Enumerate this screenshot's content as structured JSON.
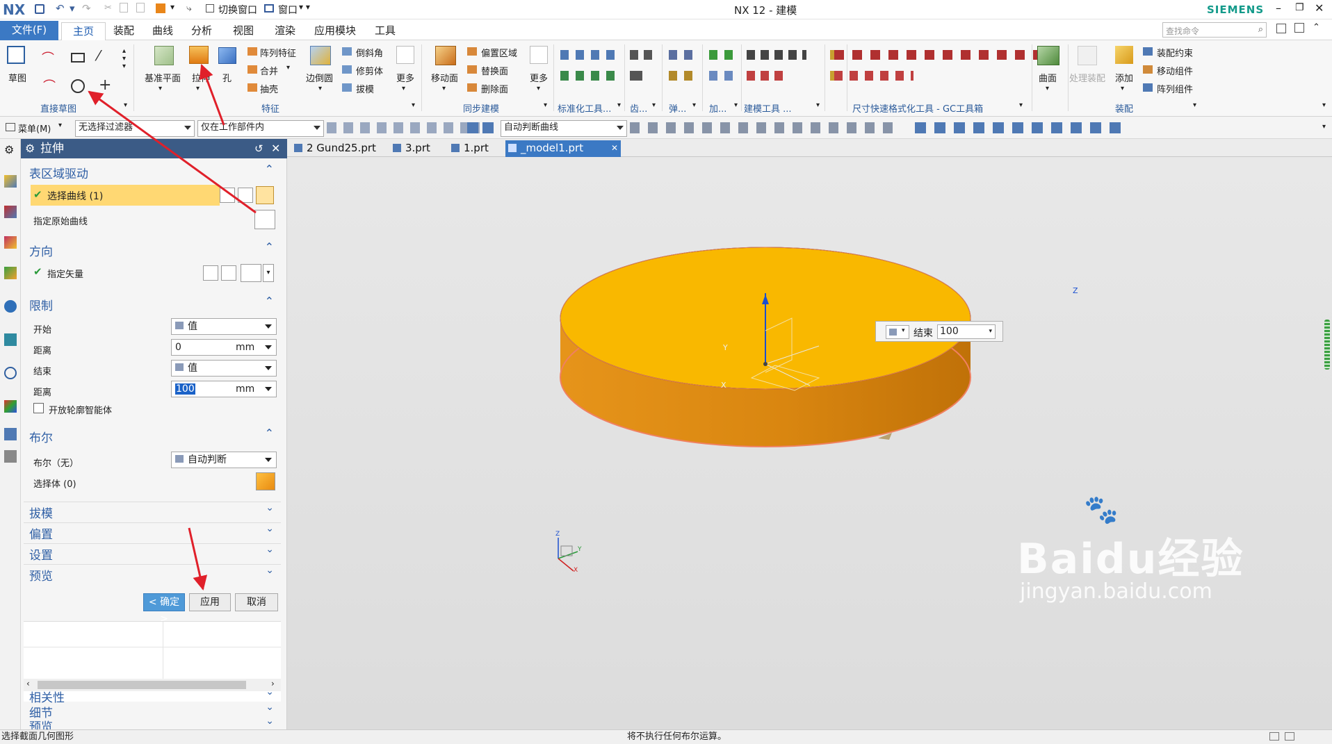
{
  "titlebar": {
    "logo": "NX",
    "quick_switch_window": "切换窗口",
    "quick_window": "窗口",
    "title": "NX 12 - 建模",
    "brand": "SIEMENS",
    "search_placeholder": "查找命令"
  },
  "menutabs": [
    "文件(F)",
    "主页",
    "装配",
    "曲线",
    "分析",
    "视图",
    "渲染",
    "应用模块",
    "工具"
  ],
  "ribbon": {
    "sketch": "草图",
    "direct_sketch_group": "直接草图",
    "datum_plane": "基准平面",
    "extrude": "拉伸",
    "hole": "孔",
    "pattern_feature": "阵列特征",
    "unite": "合并",
    "shell": "抽壳",
    "edge_blend": "边倒圆",
    "chamfer": "倒斜角",
    "trim_body": "修剪体",
    "draft": "拔模",
    "more": "更多",
    "feature_group": "特征",
    "move_face": "移动面",
    "offset_region": "偏置区域",
    "replace_face": "替换面",
    "delete_face": "删除面",
    "more2": "更多",
    "sync_group": "同步建模",
    "std_tools_group": "标准化工具...",
    "gear_group": "齿...",
    "spring_group": "弹...",
    "add_group": "加...",
    "modeling_tools_group": "建模工具 ...",
    "dim_tools_group": "尺寸快速格式化工具 - GC工具箱",
    "surface": "曲面",
    "process_assembly": "处理装配",
    "add": "添加",
    "assembly_constraint": "装配约束",
    "move_component": "移动组件",
    "pattern_component": "阵列组件",
    "assembly_group": "装配"
  },
  "toolbar2": {
    "menu": "菜单(M)",
    "filter": "无选择过滤器",
    "scope": "仅在工作部件内",
    "curve_rule": "自动判断曲线"
  },
  "panel": {
    "title": "拉伸",
    "sec_region": "表区域驱动",
    "select_curve": "选择曲线 (1)",
    "specify_origin_curve": "指定原始曲线",
    "sec_direction": "方向",
    "specify_vector": "指定矢量",
    "sec_limits": "限制",
    "start_label": "开始",
    "start_value": "值",
    "dist1_label": "距离",
    "dist1_value": "0",
    "dist1_unit": "mm",
    "end_label": "结束",
    "end_value": "值",
    "dist2_label": "距离",
    "dist2_value": "100",
    "dist2_unit": "mm",
    "open_profile": "开放轮廓智能体",
    "sec_boolean": "布尔",
    "boolean_label": "布尔（无）",
    "boolean_value": "自动判断",
    "select_body": "选择体 (0)",
    "sec_draft": "拔模",
    "sec_offset": "偏置",
    "sec_settings": "设置",
    "sec_preview": "预览",
    "ok": "< 确定 >",
    "apply": "应用",
    "cancel": "取消",
    "related": "相关性",
    "details": "细节",
    "preview2": "预览"
  },
  "doc_tabs": [
    "2 Gund25.prt",
    "3.prt",
    "1.prt",
    "_model1.prt"
  ],
  "viewport": {
    "end_label": "结束",
    "end_value": "100",
    "axis_z": "Z",
    "axis_y": "Y",
    "axis_x": "X"
  },
  "watermark": {
    "brand": "Baidu经验",
    "url": "jingyan.baidu.com"
  },
  "status": {
    "left": "选择截面几何图形",
    "center": "将不执行任何布尔运算。"
  },
  "colors": {
    "accent_blue": "#3b79c4",
    "panel_header": "#3b5b86",
    "disc_top": "#f7b500",
    "disc_side": "#e08a00",
    "arrow_red": "#e0202a",
    "selection_yellow": "#ffe28a"
  }
}
